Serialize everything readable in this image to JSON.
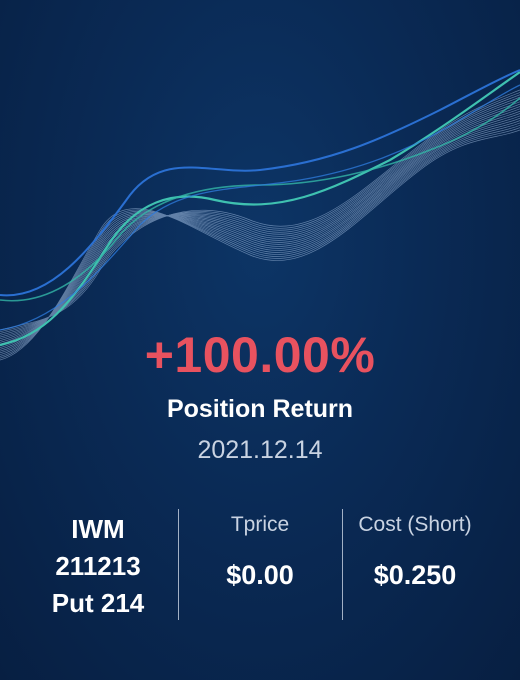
{
  "colors": {
    "background": "#0a2a55",
    "return_accent": "#e8525f",
    "muted_text": "#c9d3e2",
    "wave_teal": "#3fc1b0",
    "wave_blue": "#2a6fd1"
  },
  "position": {
    "return_pct": "+100.00%",
    "return_label": "Position Return",
    "date": "2021.12.14"
  },
  "contract": {
    "line1": "IWM",
    "line2": "211213",
    "line3": "Put 214"
  },
  "tprice": {
    "label": "Tprice",
    "value": "$0.00"
  },
  "cost": {
    "label": "Cost (Short)",
    "value": "$0.250"
  },
  "icons": {
    "background_decoration": "wave-lines-graphic"
  }
}
